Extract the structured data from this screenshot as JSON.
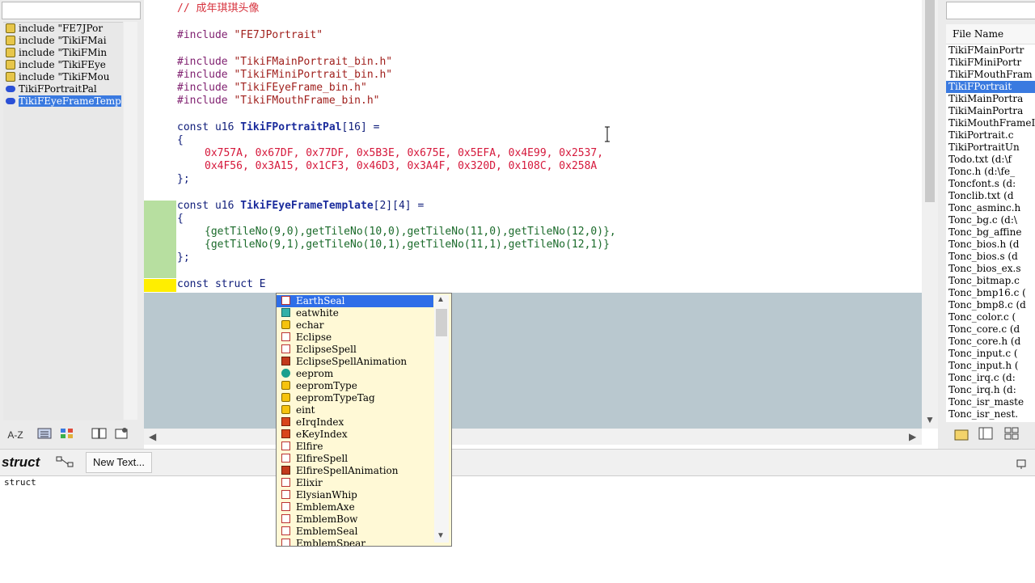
{
  "left_panel": {
    "items": [
      {
        "icon": "include-icon",
        "label": "include \"FE7JPor"
      },
      {
        "icon": "include-icon",
        "label": "include \"TikiFMai"
      },
      {
        "icon": "include-icon",
        "label": "include \"TikiFMin"
      },
      {
        "icon": "include-icon",
        "label": "include \"TikiFEye"
      },
      {
        "icon": "include-icon",
        "label": "include \"TikiFMou"
      },
      {
        "icon": "variable-icon",
        "label": "TikiFPortraitPal"
      },
      {
        "icon": "variable-icon",
        "label": "TikiFEyeFrameTemp",
        "selected": true
      }
    ],
    "toolbar": {
      "az_label": "A-Z"
    }
  },
  "editor": {
    "comment": "// 成年琪琪头像",
    "lines": {
      "inc0_kw": "#include",
      "inc0_str": "\"FE7JPortrait\"",
      "inc1_kw": "#include",
      "inc1_str": "\"TikiFMainPortrait_bin.h\"",
      "inc2_kw": "#include",
      "inc2_str": "\"TikiFMiniPortrait_bin.h\"",
      "inc3_kw": "#include",
      "inc3_str": "\"TikiFEyeFrame_bin.h\"",
      "inc4_kw": "#include",
      "inc4_str": "\"TikiFMouthFrame_bin.h\"",
      "pal_decl_a": "const u16 ",
      "pal_decl_name": "TikiFPortraitPal",
      "pal_decl_b": "[16] =",
      "brace_open": "{",
      "pal_row1": "0x757A, 0x67DF, 0x77DF, 0x5B3E, 0x675E, 0x5EFA, 0x4E99, 0x2537,",
      "pal_row2": "0x4F56, 0x3A15, 0x1CF3, 0x46D3, 0x3A4F, 0x320D, 0x108C, 0x258A",
      "brace_close": "};",
      "eye_decl_a": "const u16 ",
      "eye_decl_name": "TikiFEyeFrameTemplate",
      "eye_decl_b": "[2][4] =",
      "eye_row1": "{getTileNo(9,0),getTileNo(10,0),getTileNo(11,0),getTileNo(12,0)},",
      "eye_row2": "{getTileNo(9,1),getTileNo(10,1),getTileNo(11,1),getTileNo(12,1)}",
      "current_line": "const struct E"
    }
  },
  "autocomplete": {
    "items": [
      {
        "icon": "macro-icon",
        "label": "EarthSeal",
        "selected": true
      },
      {
        "icon": "function-icon",
        "label": "eatwhite"
      },
      {
        "icon": "type-icon",
        "label": "echar"
      },
      {
        "icon": "macro-icon",
        "label": "Eclipse"
      },
      {
        "icon": "macro-icon",
        "label": "EclipseSpell"
      },
      {
        "icon": "define-icon",
        "label": "EclipseSpellAnimation"
      },
      {
        "icon": "variable-icon",
        "label": "eeprom"
      },
      {
        "icon": "type-icon",
        "label": "eepromType"
      },
      {
        "icon": "struct-icon",
        "label": "eepromTypeTag"
      },
      {
        "icon": "type-icon",
        "label": "eint"
      },
      {
        "icon": "enum-icon",
        "label": "eIrqIndex"
      },
      {
        "icon": "enum-icon",
        "label": "eKeyIndex"
      },
      {
        "icon": "macro-icon",
        "label": "Elfire"
      },
      {
        "icon": "macro-icon",
        "label": "ElfireSpell"
      },
      {
        "icon": "define-icon",
        "label": "ElfireSpellAnimation"
      },
      {
        "icon": "macro-icon",
        "label": "Elixir"
      },
      {
        "icon": "macro-icon",
        "label": "ElysianWhip"
      },
      {
        "icon": "macro-icon",
        "label": "EmblemAxe"
      },
      {
        "icon": "macro-icon",
        "label": "EmblemBow"
      },
      {
        "icon": "macro-icon",
        "label": "EmblemSeal"
      },
      {
        "icon": "macro-icon",
        "label": "EmblemSpear"
      }
    ]
  },
  "right_panel": {
    "header": "File Name",
    "items": [
      {
        "label": "TikiFMainPortr"
      },
      {
        "label": "TikiFMiniPortr"
      },
      {
        "label": "TikiFMouthFram"
      },
      {
        "label": "TikiFPortrait",
        "selected": true
      },
      {
        "label": "TikiMainPortra"
      },
      {
        "label": "TikiMainPortra"
      },
      {
        "label": "TikiMouthFrameI"
      },
      {
        "label": "TikiPortrait.c"
      },
      {
        "label": "TikiPortraitUn"
      },
      {
        "label": "Todo.txt (d:\\f"
      },
      {
        "label": "Tonc.h (d:\\fe_"
      },
      {
        "label": "Toncfont.s (d:"
      },
      {
        "label": "Tonclib.txt (d"
      },
      {
        "label": "Tonc_asminc.h"
      },
      {
        "label": "Tonc_bg.c (d:\\"
      },
      {
        "label": "Tonc_bg_affine"
      },
      {
        "label": "Tonc_bios.h (d"
      },
      {
        "label": "Tonc_bios.s (d"
      },
      {
        "label": "Tonc_bios_ex.s"
      },
      {
        "label": "Tonc_bitmap.c"
      },
      {
        "label": "Tonc_bmp16.c ("
      },
      {
        "label": "Tonc_bmp8.c (d"
      },
      {
        "label": "Tonc_color.c ("
      },
      {
        "label": "Tonc_core.c (d"
      },
      {
        "label": "Tonc_core.h (d"
      },
      {
        "label": "Tonc_input.c ("
      },
      {
        "label": "Tonc_input.h ("
      },
      {
        "label": "Tonc_irq.c (d:"
      },
      {
        "label": "Tonc_irq.h (d:"
      },
      {
        "label": "Tonc_isr_maste"
      },
      {
        "label": "Tonc_isr_nest."
      }
    ]
  },
  "bottom": {
    "title": "struct",
    "tab_label": "New Text...",
    "content": "struct"
  }
}
